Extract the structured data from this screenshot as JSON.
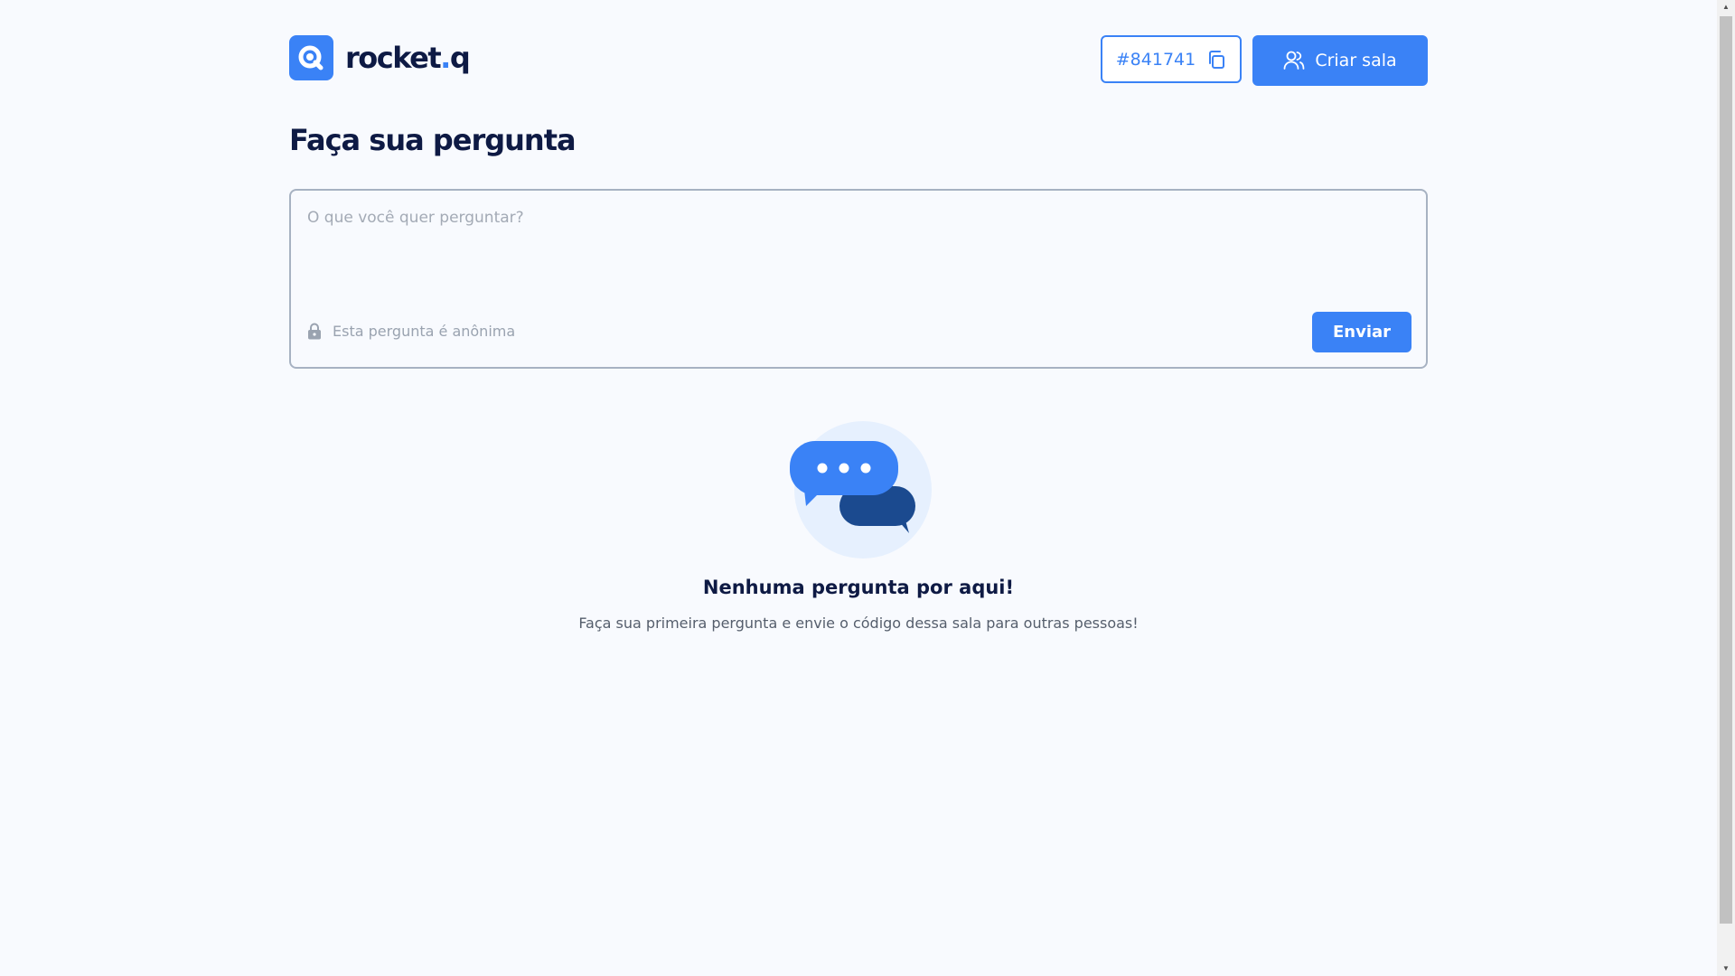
{
  "header": {
    "logo_text": "rocket",
    "logo_dot": ".",
    "logo_suffix": "q",
    "room_code": "#841741",
    "create_room_label": "Criar sala"
  },
  "main": {
    "title": "Faça sua pergunta",
    "question_placeholder": "O que você quer perguntar?",
    "anonymous_note": "Esta pergunta é anônima",
    "send_label": "Enviar"
  },
  "empty_state": {
    "title": "Nenhuma pergunta por aqui!",
    "description": "Faça sua primeira pergunta e envie o código dessa sala para outras pessoas!"
  },
  "colors": {
    "accent": "#3a82f6",
    "heading": "#0e1a44",
    "background": "#f8fafe"
  },
  "icons": [
    "search-logo-icon",
    "copy-icon",
    "users-icon",
    "lock-icon",
    "chat-bubbles-illustration"
  ]
}
